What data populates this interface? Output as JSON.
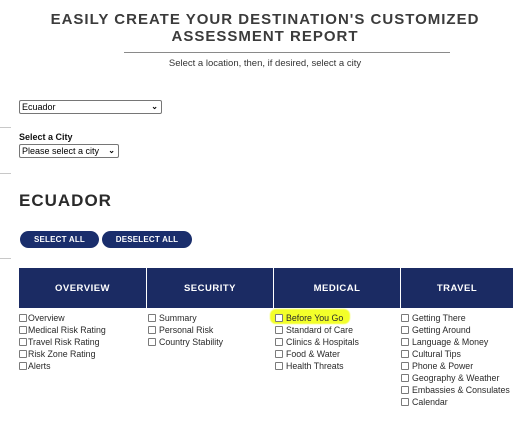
{
  "header": {
    "title_line1": "EASILY CREATE YOUR DESTINATION'S CUSTOMIZED",
    "title_line2": "ASSESSMENT REPORT",
    "subtitle": "Select a location, then, if desired, select a city"
  },
  "location": {
    "country_value": "Ecuador",
    "city_label": "Select a City",
    "city_value": "Please select a city"
  },
  "country_heading": "ECUADOR",
  "buttons": {
    "select_all": "SELECT ALL",
    "deselect_all": "DESELECT ALL"
  },
  "columns": {
    "overview": {
      "header": "OVERVIEW",
      "items": [
        "Overview",
        "Medical Risk Rating",
        "Travel Risk Rating",
        "Risk Zone Rating",
        "Alerts"
      ]
    },
    "security": {
      "header": "SECURITY",
      "items": [
        "Summary",
        "Personal Risk",
        "Country Stability"
      ]
    },
    "medical": {
      "header": "MEDICAL",
      "items": [
        "Before You Go",
        "Standard of Care",
        "Clinics & Hospitals",
        "Food & Water",
        "Health Threats"
      ]
    },
    "travel": {
      "header": "TRAVEL",
      "items": [
        "Getting There",
        "Getting Around",
        "Language & Money",
        "Cultural Tips",
        "Phone & Power",
        "Geography & Weather",
        "Embassies & Consulates",
        "Calendar"
      ]
    }
  },
  "colors": {
    "header_bg": "#1b2b63",
    "button_bg": "#1a2e6c",
    "highlight": "#f3ff2a"
  },
  "icons": {
    "dropdown": "chevron-down-icon",
    "checkbox": "checkbox-icon"
  }
}
